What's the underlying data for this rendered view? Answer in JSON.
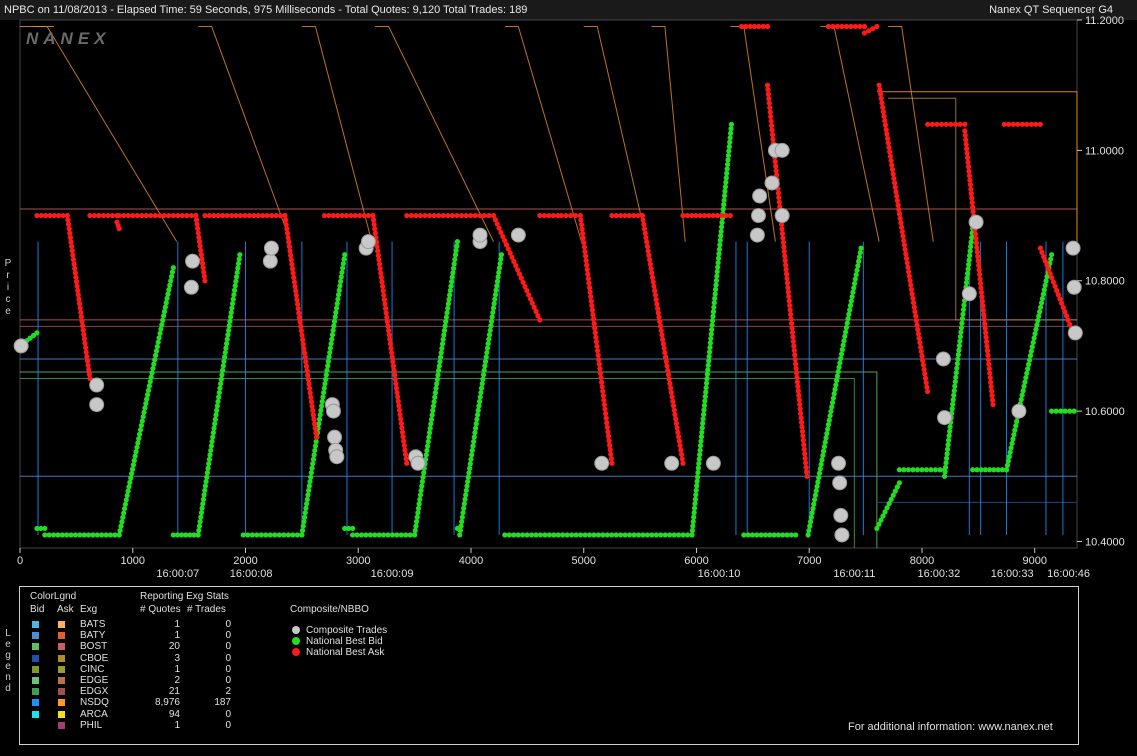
{
  "header": {
    "left_text": "NPBC on 11/08/2013  -  Elapsed Time: 59 Seconds, 975 Milliseconds  -  Total Quotes: 9,120  Total Trades: 189",
    "right_text": "Nanex QT Sequencer G4",
    "logo": "NANEX"
  },
  "side_labels": {
    "price": "Price",
    "legend": "Legend"
  },
  "chart_data": {
    "type": "scatter",
    "x_ticks": [
      "0",
      "1000",
      "2000",
      "3000",
      "4000",
      "5000",
      "6000",
      "7000",
      "8000",
      "9000"
    ],
    "x_tick_values": [
      0,
      1000,
      2000,
      3000,
      4000,
      5000,
      6000,
      7000,
      8000,
      9000
    ],
    "time_labels": [
      {
        "x": 1400,
        "label": "16:00:07"
      },
      {
        "x": 2050,
        "label": "16:00:08"
      },
      {
        "x": 3300,
        "label": "16:00:09"
      },
      {
        "x": 6200,
        "label": "16:00:10"
      },
      {
        "x": 7400,
        "label": "16:00:11"
      },
      {
        "x": 8150,
        "label": "16:00:32"
      },
      {
        "x": 8800,
        "label": "16:00:33"
      },
      {
        "x": 9300,
        "label": "16:00:46"
      }
    ],
    "y_ticks": [
      "10.4000",
      "10.6000",
      "10.8000",
      "11.0000",
      "11.2000"
    ],
    "y_tick_values": [
      10.4,
      10.6,
      10.8,
      11.0,
      11.2
    ],
    "xlim": [
      0,
      9375
    ],
    "ylim": [
      10.39,
      11.2
    ],
    "series": [
      {
        "name": "National Best Bid",
        "color": "#22dd22",
        "segments": [
          [
            [
              0,
              10.7
            ],
            [
              150,
              10.72
            ]
          ],
          [
            [
              150,
              10.42
            ],
            [
              220,
              10.42
            ]
          ],
          [
            [
              220,
              10.41
            ],
            [
              880,
              10.41
            ]
          ],
          [
            [
              880,
              10.41
            ],
            [
              1360,
              10.82
            ]
          ],
          [
            [
              1360,
              10.41
            ],
            [
              1580,
              10.41
            ]
          ],
          [
            [
              1580,
              10.41
            ],
            [
              1950,
              10.84
            ]
          ],
          [
            [
              1980,
              10.41
            ],
            [
              2500,
              10.41
            ]
          ],
          [
            [
              2500,
              10.41
            ],
            [
              2880,
              10.84
            ]
          ],
          [
            [
              2880,
              10.42
            ],
            [
              2950,
              10.42
            ]
          ],
          [
            [
              2950,
              10.41
            ],
            [
              3500,
              10.41
            ]
          ],
          [
            [
              3500,
              10.41
            ],
            [
              3880,
              10.86
            ]
          ],
          [
            [
              3880,
              10.42
            ],
            [
              3900,
              10.42
            ]
          ],
          [
            [
              3900,
              10.41
            ],
            [
              4270,
              10.84
            ]
          ],
          [
            [
              4300,
              10.41
            ],
            [
              5960,
              10.41
            ]
          ],
          [
            [
              5960,
              10.41
            ],
            [
              6310,
              11.04
            ]
          ],
          [
            [
              6420,
              10.41
            ],
            [
              6880,
              10.41
            ]
          ],
          [
            [
              6990,
              10.41
            ],
            [
              7460,
              10.85
            ]
          ],
          [
            [
              7600,
              10.42
            ],
            [
              7800,
              10.49
            ]
          ],
          [
            [
              7800,
              10.51
            ],
            [
              8200,
              10.51
            ]
          ],
          [
            [
              8200,
              10.5
            ],
            [
              8450,
              10.88
            ]
          ],
          [
            [
              8450,
              10.51
            ],
            [
              8750,
              10.51
            ]
          ],
          [
            [
              8750,
              10.51
            ],
            [
              9150,
              10.84
            ]
          ],
          [
            [
              9150,
              10.6
            ],
            [
              9350,
              10.6
            ]
          ]
        ]
      },
      {
        "name": "National Best Ask",
        "color": "#ff1a1a",
        "segments": [
          [
            [
              150,
              10.9
            ],
            [
              420,
              10.9
            ]
          ],
          [
            [
              420,
              10.9
            ],
            [
              620,
              10.65
            ]
          ],
          [
            [
              620,
              10.9
            ],
            [
              860,
              10.9
            ]
          ],
          [
            [
              860,
              10.89
            ],
            [
              880,
              10.88
            ]
          ],
          [
            [
              880,
              10.9
            ],
            [
              1560,
              10.9
            ]
          ],
          [
            [
              1560,
              10.9
            ],
            [
              1640,
              10.8
            ]
          ],
          [
            [
              1640,
              10.9
            ],
            [
              2350,
              10.9
            ]
          ],
          [
            [
              2350,
              10.9
            ],
            [
              2630,
              10.56
            ]
          ],
          [
            [
              2700,
              10.9
            ],
            [
              3130,
              10.9
            ]
          ],
          [
            [
              3130,
              10.9
            ],
            [
              3430,
              10.52
            ]
          ],
          [
            [
              3430,
              10.9
            ],
            [
              4200,
              10.9
            ]
          ],
          [
            [
              4200,
              10.9
            ],
            [
              4610,
              10.74
            ]
          ],
          [
            [
              4610,
              10.9
            ],
            [
              4770,
              10.9
            ]
          ],
          [
            [
              4800,
              10.9
            ],
            [
              4970,
              10.9
            ]
          ],
          [
            [
              4970,
              10.9
            ],
            [
              5250,
              10.52
            ]
          ],
          [
            [
              5250,
              10.9
            ],
            [
              5520,
              10.9
            ]
          ],
          [
            [
              5520,
              10.9
            ],
            [
              5880,
              10.52
            ]
          ],
          [
            [
              5880,
              10.9
            ],
            [
              6300,
              10.9
            ]
          ],
          [
            [
              6400,
              11.19
            ],
            [
              6630,
              11.19
            ]
          ],
          [
            [
              6630,
              11.1
            ],
            [
              6980,
              10.5
            ]
          ],
          [
            [
              7170,
              11.19
            ],
            [
              7490,
              11.19
            ]
          ],
          [
            [
              7490,
              11.18
            ],
            [
              7600,
              11.19
            ]
          ],
          [
            [
              7620,
              11.1
            ],
            [
              8050,
              10.63
            ]
          ],
          [
            [
              8050,
              11.04
            ],
            [
              8380,
              11.04
            ]
          ],
          [
            [
              8380,
              11.03
            ],
            [
              8630,
              10.61
            ]
          ],
          [
            [
              8730,
              11.04
            ],
            [
              9050,
              11.04
            ]
          ],
          [
            [
              9050,
              10.85
            ],
            [
              9340,
              10.72
            ]
          ]
        ]
      },
      {
        "name": "Composite Trades",
        "color": "#c8c8c8",
        "points": [
          [
            10,
            10.7
          ],
          [
            680,
            10.64
          ],
          [
            680,
            10.61
          ],
          [
            1520,
            10.79
          ],
          [
            1530,
            10.83
          ],
          [
            2220,
            10.83
          ],
          [
            2230,
            10.85
          ],
          [
            2770,
            10.61
          ],
          [
            2780,
            10.6
          ],
          [
            2790,
            10.56
          ],
          [
            2800,
            10.54
          ],
          [
            2810,
            10.53
          ],
          [
            3070,
            10.85
          ],
          [
            3090,
            10.86
          ],
          [
            3510,
            10.53
          ],
          [
            3530,
            10.52
          ],
          [
            4080,
            10.86
          ],
          [
            4080,
            10.87
          ],
          [
            4420,
            10.87
          ],
          [
            5160,
            10.52
          ],
          [
            5780,
            10.52
          ],
          [
            6150,
            10.52
          ],
          [
            6540,
            10.87
          ],
          [
            6550,
            10.9
          ],
          [
            6560,
            10.93
          ],
          [
            6670,
            10.95
          ],
          [
            6700,
            11.0
          ],
          [
            6760,
            11.0
          ],
          [
            6760,
            10.9
          ],
          [
            7260,
            10.52
          ],
          [
            7270,
            10.49
          ],
          [
            7280,
            10.44
          ],
          [
            7290,
            10.41
          ],
          [
            8190,
            10.68
          ],
          [
            8200,
            10.59
          ],
          [
            8420,
            10.78
          ],
          [
            8480,
            10.89
          ],
          [
            8860,
            10.6
          ],
          [
            9340,
            10.85
          ],
          [
            9350,
            10.79
          ],
          [
            9360,
            10.72
          ]
        ]
      }
    ]
  },
  "legend": {
    "color_legend": "ColorLgnd",
    "reporting": "Reporting Exg Stats",
    "composite": "Composite/NBBO",
    "col_bid": "Bid",
    "col_ask": "Ask",
    "col_exg": "Exg",
    "col_quotes": "# Quotes",
    "col_trades": "# Trades",
    "exchanges": [
      {
        "name": "BATS",
        "quotes": "1",
        "trades": "0",
        "bid_color": "#4fb3e6",
        "ask_color": "#ffb060"
      },
      {
        "name": "BATY",
        "quotes": "1",
        "trades": "0",
        "bid_color": "#4a8fd6",
        "ask_color": "#e06030"
      },
      {
        "name": "BOST",
        "quotes": "20",
        "trades": "0",
        "bid_color": "#5fbf5f",
        "ask_color": "#c86060"
      },
      {
        "name": "CBOE",
        "quotes": "3",
        "trades": "0",
        "bid_color": "#2050a8",
        "ask_color": "#b08a30"
      },
      {
        "name": "CINC",
        "quotes": "1",
        "trades": "0",
        "bid_color": "#7a9a30",
        "ask_color": "#9a9a30"
      },
      {
        "name": "EDGE",
        "quotes": "2",
        "trades": "0",
        "bid_color": "#6fbf7f",
        "ask_color": "#b87050"
      },
      {
        "name": "EDGX",
        "quotes": "21",
        "trades": "2",
        "bid_color": "#3f9f4f",
        "ask_color": "#a05050"
      },
      {
        "name": "NSDQ",
        "quotes": "8,976",
        "trades": "187",
        "bid_color": "#1e90ff",
        "ask_color": "#ff9a20"
      },
      {
        "name": "ARCA",
        "quotes": "94",
        "trades": "0",
        "bid_color": "#20e0f0",
        "ask_color": "#f0e020"
      },
      {
        "name": "PHIL",
        "quotes": "1",
        "trades": "0",
        "bid_color": "#000000",
        "ask_color": "#a04070"
      }
    ],
    "composite_items": [
      {
        "label": "Composite Trades",
        "color": "#c8c8c8"
      },
      {
        "label": "National Best Bid",
        "color": "#22dd22"
      },
      {
        "label": "National Best Ask",
        "color": "#ff1a1a"
      }
    ],
    "footer": "For additional information: www.nanex.net"
  }
}
